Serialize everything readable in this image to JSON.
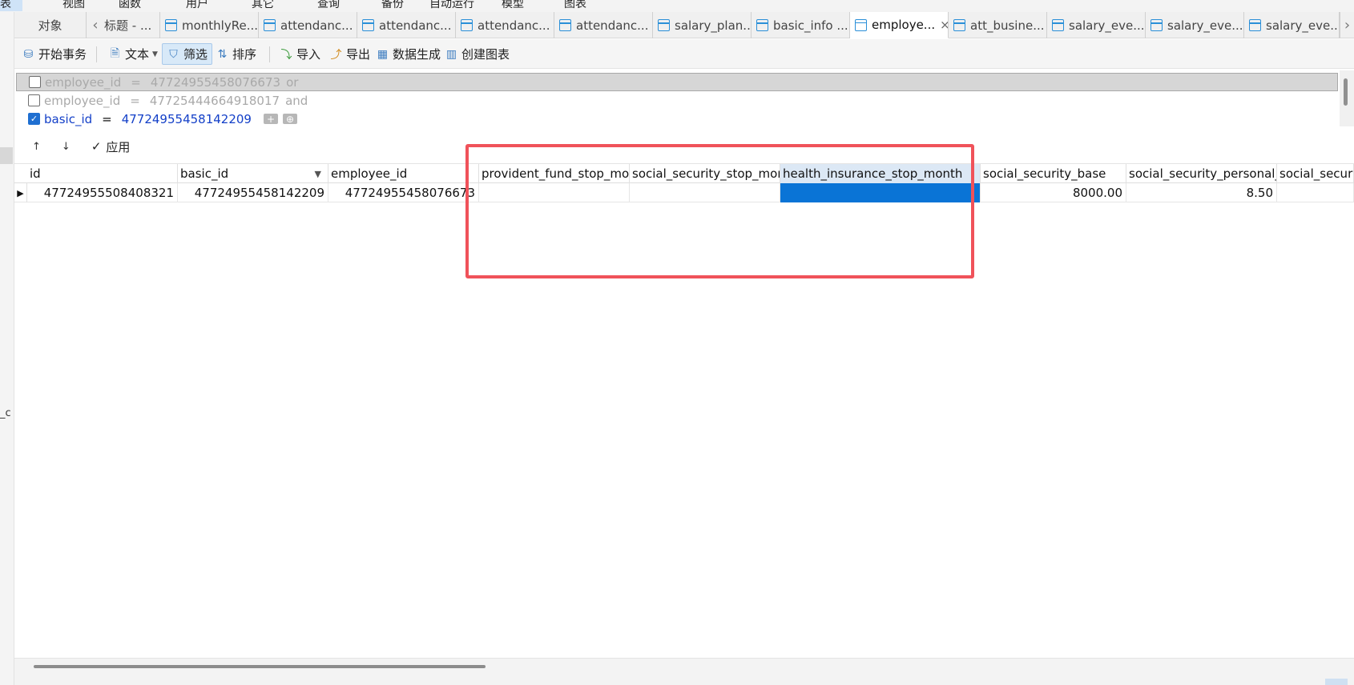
{
  "menu": {
    "items": [
      "表",
      "视图",
      "函数",
      "用户",
      "其它",
      "查询",
      "备份",
      "自动运行",
      "模型",
      "图表"
    ]
  },
  "left_gutter": {
    "text": "_c"
  },
  "tabs": {
    "objects_label": "对象",
    "items": [
      {
        "label": "标题 - ...",
        "icon": "none"
      },
      {
        "label": "monthlyRe...",
        "icon": "table-icon"
      },
      {
        "label": "attendanc...",
        "icon": "table-icon"
      },
      {
        "label": "attendanc...",
        "icon": "table-icon"
      },
      {
        "label": "attendanc...",
        "icon": "table-icon"
      },
      {
        "label": "attendanc...",
        "icon": "table-icon"
      },
      {
        "label": "salary_plan...",
        "icon": "table-icon"
      },
      {
        "label": "basic_info ...",
        "icon": "table-icon"
      },
      {
        "label": "employe...",
        "icon": "table-icon",
        "active": true
      },
      {
        "label": "att_busine...",
        "icon": "table-icon"
      },
      {
        "label": "salary_eve...",
        "icon": "table-icon"
      },
      {
        "label": "salary_eve...",
        "icon": "table-icon"
      },
      {
        "label": "salary_eve...",
        "icon": "table-icon"
      }
    ]
  },
  "toolbar": {
    "begin_transaction": "开始事务",
    "text": "文本",
    "filter": "筛选",
    "sort": "排序",
    "import": "导入",
    "export": "导出",
    "data_generation": "数据生成",
    "create_chart": "创建图表"
  },
  "filters": [
    {
      "field": "employee_id",
      "op": "=",
      "value": "47724955458076673",
      "conj": "or",
      "checked": false,
      "selected": true
    },
    {
      "field": "employee_id",
      "op": "=",
      "value": "47725444664918017",
      "conj": "and",
      "checked": false,
      "selected": false
    },
    {
      "field": "basic_id",
      "op": "=",
      "value": "47724955458142209",
      "conj": "",
      "checked": true,
      "selected": false
    }
  ],
  "filter_actions": {
    "up": "↑",
    "down": "↓",
    "apply": "应用"
  },
  "grid": {
    "columns": [
      "id",
      "basic_id",
      "employee_id",
      "provident_fund_stop_mo",
      "social_security_stop_mon",
      "health_insurance_stop_month",
      "social_security_base",
      "social_security_personal_r",
      "social_securi"
    ],
    "rows": [
      [
        "47724955508408321",
        "47724955458142209",
        "47724955458076673",
        "",
        "",
        "",
        "8000.00",
        "8.50",
        ""
      ]
    ],
    "selected_column": "health_insurance_stop_month",
    "filtered_column": "basic_id"
  },
  "colors": {
    "selection": "#0a74d6",
    "highlight_box": "#f0525a",
    "filter_value": "#1440c8"
  }
}
